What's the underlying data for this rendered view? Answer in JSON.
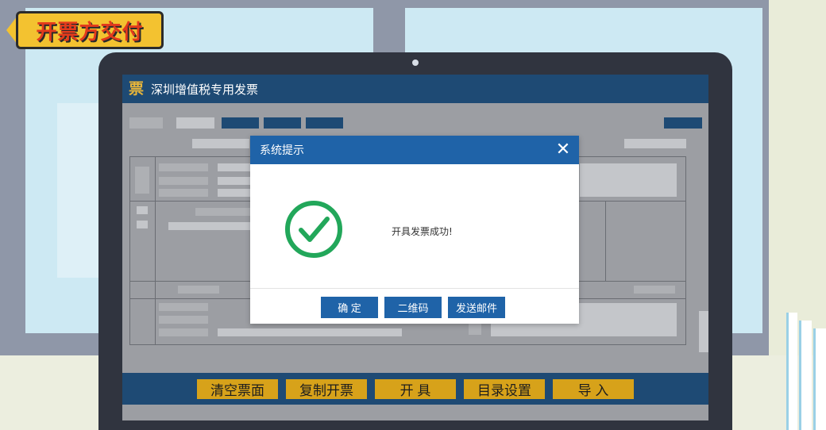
{
  "ribbon": {
    "label": "开票方交付"
  },
  "app": {
    "title": "深圳增值税专用发票",
    "logo_glyph": "票"
  },
  "dialog": {
    "title": "系统提示",
    "close_glyph": "✕",
    "message": "开具发票成功!",
    "icon": "success-check-icon",
    "buttons": {
      "confirm": "确 定",
      "qrcode": "二维码",
      "email": "发送邮件"
    }
  },
  "toolbar": {
    "clear": "清空票面",
    "copy": "复制开票",
    "issue": "开 具",
    "catalog": "目录设置",
    "import": "导 入"
  },
  "colors": {
    "header_blue": "#1e4a74",
    "dialog_blue": "#1f63a8",
    "success_green": "#22a75a",
    "button_gold": "#d7a21a",
    "ribbon_yellow": "#f3c230",
    "ribbon_text": "#e33a1c"
  }
}
